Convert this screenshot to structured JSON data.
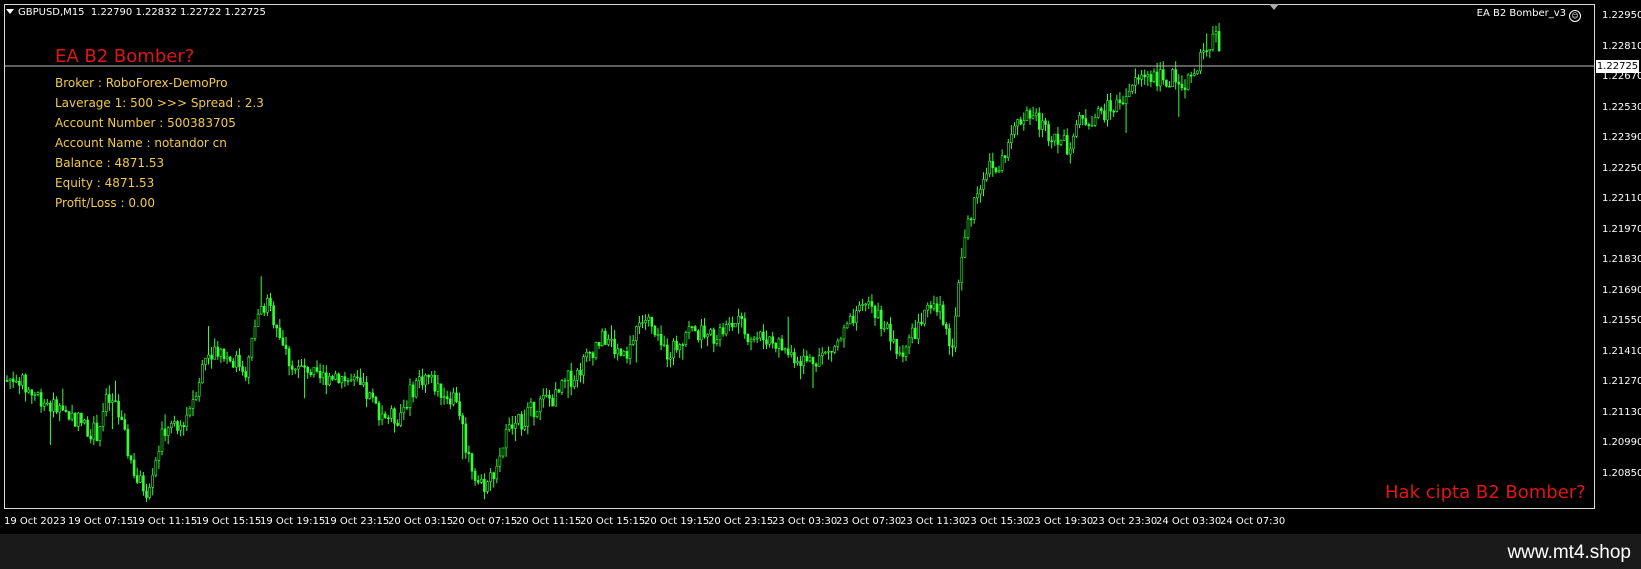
{
  "header": {
    "symbol": "GBPUSD,M15",
    "open": "1.22790",
    "high": "1.22832",
    "low": "1.22722",
    "close": "1.22725",
    "ea_name": "EA B2 Bomber_v3"
  },
  "panel": {
    "title": "EA B2 Bomber?",
    "lines": [
      "Broker : RoboForex-DemoPro",
      "Laverage  1: 500   >>> Spread : 2.3",
      "Account Number   : 500383705",
      "Account Name   : notandor cn",
      "Balance : 4871.53",
      "Equity : 4871.53",
      "Profit/Loss : 0.00"
    ]
  },
  "copyright": "Hak cipta B2 Bomber?",
  "watermark": "www.mt4.shop",
  "current_price": "1.22725",
  "price_axis": [
    "1.22950",
    "1.22810",
    "1.22670",
    "1.22530",
    "1.22390",
    "1.22250",
    "1.22110",
    "1.21970",
    "1.21830",
    "1.21690",
    "1.21550",
    "1.21410",
    "1.21270",
    "1.21130",
    "1.20990",
    "1.20850"
  ],
  "time_axis": [
    "19 Oct 2023",
    "19 Oct 07:15",
    "19 Oct 11:15",
    "19 Oct 15:15",
    "19 Oct 19:15",
    "19 Oct 23:15",
    "20 Oct 03:15",
    "20 Oct 07:15",
    "20 Oct 11:15",
    "20 Oct 15:15",
    "20 Oct 19:15",
    "20 Oct 23:15",
    "23 Oct 03:30",
    "23 Oct 07:30",
    "23 Oct 11:30",
    "23 Oct 15:30",
    "23 Oct 19:30",
    "23 Oct 23:30",
    "24 Oct 03:30",
    "24 Oct 07:30"
  ],
  "colors": {
    "background": "#000000",
    "candle": "#33ff33",
    "text": "#ffffff",
    "title": "#e01515",
    "info": "#f2c94c"
  },
  "chart_data": {
    "type": "candlestick",
    "price_range": [
      1.2085,
      1.2302
    ],
    "bars_count": 400,
    "close_path": [
      [
        0,
        1.214
      ],
      [
        10,
        1.2142
      ],
      [
        20,
        1.2136
      ],
      [
        30,
        1.2134
      ],
      [
        40,
        1.2131
      ],
      [
        50,
        1.2128
      ],
      [
        60,
        1.2126
      ],
      [
        70,
        1.2124
      ],
      [
        80,
        1.212
      ],
      [
        90,
        1.2118
      ],
      [
        100,
        1.2132
      ],
      [
        110,
        1.2128
      ],
      [
        120,
        1.2112
      ],
      [
        130,
        1.2098
      ],
      [
        140,
        1.2094
      ],
      [
        150,
        1.211
      ],
      [
        160,
        1.2122
      ],
      [
        170,
        1.2118
      ],
      [
        180,
        1.2126
      ],
      [
        190,
        1.2138
      ],
      [
        200,
        1.2152
      ],
      [
        210,
        1.2154
      ],
      [
        220,
        1.215
      ],
      [
        230,
        1.2148
      ],
      [
        240,
        1.2144
      ],
      [
        250,
        1.2168
      ],
      [
        260,
        1.2172
      ],
      [
        270,
        1.2164
      ],
      [
        280,
        1.215
      ],
      [
        290,
        1.2144
      ],
      [
        300,
        1.2146
      ],
      [
        310,
        1.214
      ],
      [
        320,
        1.2142
      ],
      [
        330,
        1.2143
      ],
      [
        340,
        1.214
      ],
      [
        350,
        1.2138
      ],
      [
        360,
        1.2134
      ],
      [
        370,
        1.2128
      ],
      [
        380,
        1.2125
      ],
      [
        390,
        1.2124
      ],
      [
        400,
        1.2132
      ],
      [
        410,
        1.214
      ],
      [
        420,
        1.2142
      ],
      [
        430,
        1.2137
      ],
      [
        440,
        1.2134
      ],
      [
        450,
        1.2133
      ],
      [
        460,
        1.211
      ],
      [
        470,
        1.2098
      ],
      [
        480,
        1.2096
      ],
      [
        490,
        1.2105
      ],
      [
        500,
        1.2118
      ],
      [
        510,
        1.2122
      ],
      [
        520,
        1.2125
      ],
      [
        530,
        1.213
      ],
      [
        540,
        1.2132
      ],
      [
        550,
        1.2133
      ],
      [
        560,
        1.214
      ],
      [
        570,
        1.2143
      ],
      [
        580,
        1.215
      ],
      [
        590,
        1.2156
      ],
      [
        600,
        1.2158
      ],
      [
        610,
        1.2152
      ],
      [
        620,
        1.2148
      ],
      [
        630,
        1.2164
      ],
      [
        640,
        1.2166
      ],
      [
        650,
        1.2156
      ],
      [
        660,
        1.2152
      ],
      [
        670,
        1.2155
      ],
      [
        680,
        1.2162
      ],
      [
        690,
        1.216
      ],
      [
        700,
        1.2158
      ],
      [
        710,
        1.216
      ],
      [
        720,
        1.2162
      ],
      [
        730,
        1.2165
      ],
      [
        740,
        1.216
      ],
      [
        750,
        1.2158
      ],
      [
        760,
        1.2158
      ],
      [
        770,
        1.2156
      ],
      [
        780,
        1.2152
      ],
      [
        790,
        1.215
      ],
      [
        800,
        1.2148
      ],
      [
        810,
        1.215
      ],
      [
        820,
        1.2151
      ],
      [
        830,
        1.2155
      ],
      [
        840,
        1.2162
      ],
      [
        850,
        1.2166
      ],
      [
        860,
        1.2174
      ],
      [
        870,
        1.2168
      ],
      [
        880,
        1.2162
      ],
      [
        890,
        1.215
      ],
      [
        900,
        1.2156
      ],
      [
        910,
        1.2162
      ],
      [
        920,
        1.2168
      ],
      [
        930,
        1.217
      ],
      [
        940,
        1.2165
      ],
      [
        945,
        1.215
      ],
      [
        950,
        1.2178
      ],
      [
        960,
        1.2205
      ],
      [
        970,
        1.222
      ],
      [
        980,
        1.223
      ],
      [
        990,
        1.2228
      ],
      [
        1000,
        1.2238
      ],
      [
        1010,
        1.2248
      ],
      [
        1020,
        1.2254
      ],
      [
        1030,
        1.225
      ],
      [
        1040,
        1.2245
      ],
      [
        1050,
        1.2244
      ],
      [
        1060,
        1.2238
      ],
      [
        1070,
        1.2248
      ],
      [
        1080,
        1.225
      ],
      [
        1090,
        1.2252
      ],
      [
        1100,
        1.2254
      ],
      [
        1110,
        1.2256
      ],
      [
        1120,
        1.2262
      ],
      [
        1130,
        1.2266
      ],
      [
        1140,
        1.227
      ],
      [
        1150,
        1.2268
      ],
      [
        1160,
        1.2266
      ],
      [
        1170,
        1.2268
      ],
      [
        1180,
        1.2266
      ],
      [
        1190,
        1.227
      ],
      [
        1200,
        1.2283
      ],
      [
        1210,
        1.2285
      ],
      [
        1215,
        1.22725
      ]
    ]
  }
}
